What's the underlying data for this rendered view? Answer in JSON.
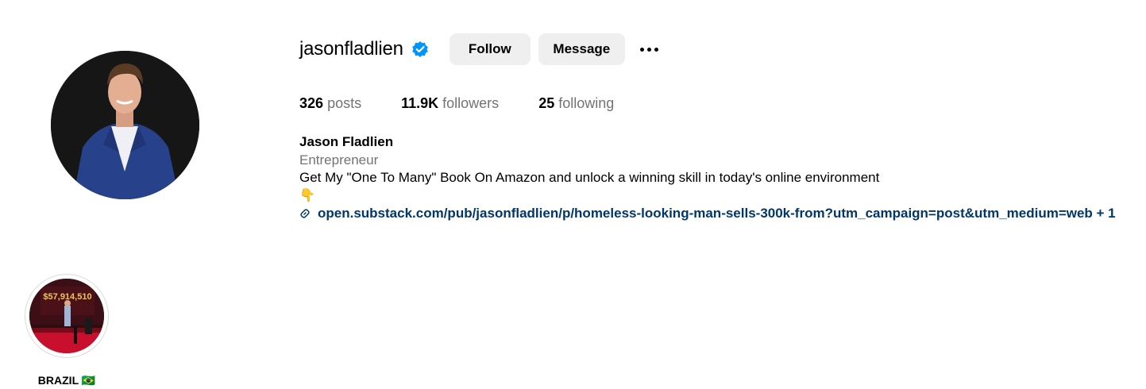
{
  "profile": {
    "username": "jasonfladlien",
    "verified_icon": "verified-badge-icon",
    "follow_label": "Follow",
    "message_label": "Message",
    "more_icon": "more-options-icon"
  },
  "stats": {
    "posts_count": "326",
    "posts_label": "posts",
    "followers_count": "11.9K",
    "followers_label": "followers",
    "following_count": "25",
    "following_label": "following"
  },
  "bio": {
    "full_name": "Jason Fladlien",
    "category": "Entrepreneur",
    "text": "Get My \"One To Many\" Book On Amazon and unlock a winning skill in today's online environment",
    "emoji": "👇",
    "link_icon": "link-icon",
    "link_text": "open.substack.com/pub/jasonfladlien/p/homeless-looking-man-sells-300k-from?utm_campaign=post&utm_medium=web + 1"
  },
  "highlights": [
    {
      "label": "BRAZIL 🇧🇷",
      "image_text": "$57,914,510"
    }
  ],
  "colors": {
    "verified_blue": "#0095f6",
    "link_blue": "#00376b",
    "secondary_text": "#737373",
    "button_bg": "#efefef"
  }
}
